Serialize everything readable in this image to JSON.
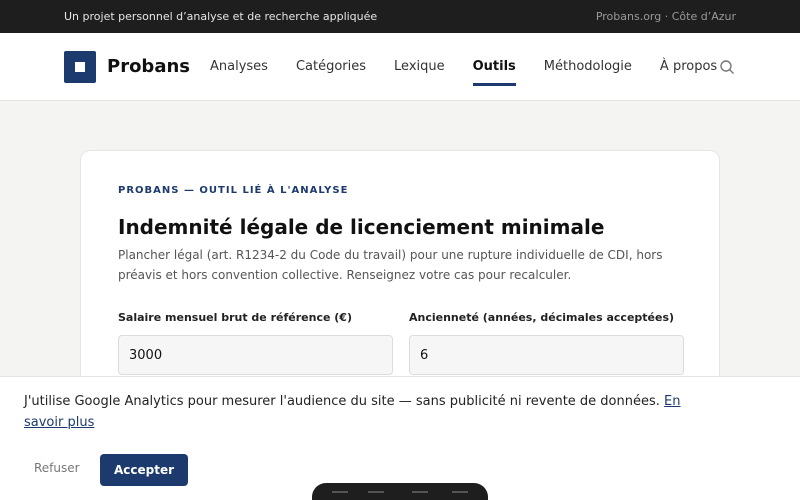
{
  "topbar": {
    "tagline": "Un projet personnel d’analyse et de recherche appliquée",
    "location": "Probans.org · Côte d’Azur"
  },
  "header": {
    "brand": "Probans",
    "nav": [
      "Analyses",
      "Catégories",
      "Lexique",
      "Outils",
      "Méthodologie",
      "À propos"
    ],
    "active_nav": "Outils",
    "search_icon": "search-icon"
  },
  "tool": {
    "eyebrow": "PROBANS — OUTIL LIÉ À L'ANALYSE",
    "title": "Indemnité légale de licenciement minimale",
    "description": "Plancher légal (art. R1234-2 du Code du travail) pour une rupture individuelle de CDI, hors préavis et hors convention collective. Renseignez votre cas pour recalculer.",
    "salary_label": "Salaire mensuel brut de référence (€)",
    "salary_value": "3000",
    "seniority_label": "Ancienneté (années, décimales acceptées)",
    "seniority_value": "6"
  },
  "cookie": {
    "text": "J'utilise Google Analytics pour mesurer l'audience du site — sans publicité ni revente de données. ",
    "link": "En savoir plus",
    "refuse": "Refuser",
    "accept": "Accepter"
  },
  "colors": {
    "accent": "#1c3a6e",
    "topbar": "#1e1e1e"
  }
}
